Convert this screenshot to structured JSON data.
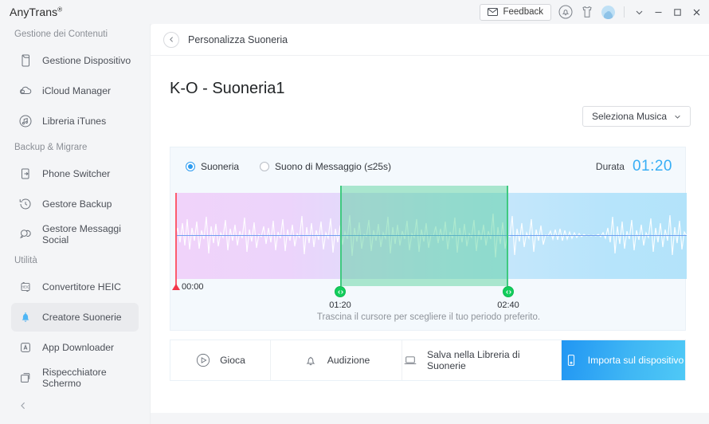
{
  "titlebar": {
    "brand": "AnyTrans",
    "brand_mark": "®",
    "feedback_label": "Feedback",
    "icons": {
      "mail": "mail-icon",
      "bell": "bell-icon",
      "shirt": "shirt-icon",
      "avatar": "user-avatar-icon",
      "chevron": "chevron-down-icon",
      "minimize": "minimize-icon",
      "maximize": "maximize-icon",
      "close": "close-icon"
    }
  },
  "sidebar": {
    "groups": [
      {
        "label": "Gestione dei Contenuti",
        "items": [
          {
            "label": "Gestione Dispositivo",
            "icon": "phone-icon",
            "active": false
          },
          {
            "label": "iCloud Manager",
            "icon": "cloud-icon",
            "active": false
          },
          {
            "label": "Libreria iTunes",
            "icon": "music-note-circle-icon",
            "active": false
          }
        ]
      },
      {
        "label": "Backup & Migrare",
        "items": [
          {
            "label": "Phone Switcher",
            "icon": "transfer-icon",
            "active": false
          },
          {
            "label": "Gestore Backup",
            "icon": "history-clock-icon",
            "active": false
          },
          {
            "label": "Gestore Messaggi Social",
            "icon": "chat-bubbles-icon",
            "active": false
          }
        ]
      },
      {
        "label": "Utilità",
        "items": [
          {
            "label": "Convertitore HEIC",
            "icon": "heic-icon",
            "active": false
          },
          {
            "label": "Creatore Suonerie",
            "icon": "bell-filled-icon",
            "active": true
          },
          {
            "label": "App Downloader",
            "icon": "appstore-icon",
            "active": false
          },
          {
            "label": "Rispecchiatore Schermo",
            "icon": "screen-mirror-icon",
            "active": false
          }
        ]
      }
    ],
    "collapse_icon": "chevron-left-icon"
  },
  "main": {
    "breadcrumb": "Personalizza Suoneria",
    "back_icon": "chevron-left-icon",
    "page_title": "K-O - Suoneria1",
    "select_music_label": "Seleziona Musica",
    "select_music_icon": "chevron-down-icon"
  },
  "editor": {
    "options": [
      {
        "label": "Suoneria",
        "selected": true
      },
      {
        "label": "Suono di Messaggio (≤25s)",
        "selected": false
      }
    ],
    "duration_label": "Durata",
    "duration_value": "01:20",
    "hint": "Trascina il cursore per scegliere il tuo periodo preferito.",
    "timeline": {
      "start_label": "00:00",
      "selection_start_label": "01:20",
      "selection_end_label": "02:40",
      "playhead_icon": "playhead-marker-icon",
      "handle_icon": "drag-handle-arrows-icon"
    },
    "colors": {
      "selection_green": "#3fc97f",
      "playhead_red": "#f2364a",
      "duration_blue": "#37aef5",
      "wave_left": "#f0d3fa",
      "wave_right": "#b3e3fa",
      "midline_blue": "#6f9ff0"
    }
  },
  "toolbar": {
    "buttons": [
      {
        "label": "Gioca",
        "icon": "play-circle-icon",
        "primary": false
      },
      {
        "label": "Audizione",
        "icon": "bell-icon",
        "primary": false
      },
      {
        "label": "Salva nella Libreria di Suonerie",
        "icon": "laptop-icon",
        "primary": false
      },
      {
        "label": "Importa sul dispositivo",
        "icon": "device-icon",
        "primary": true
      }
    ]
  }
}
